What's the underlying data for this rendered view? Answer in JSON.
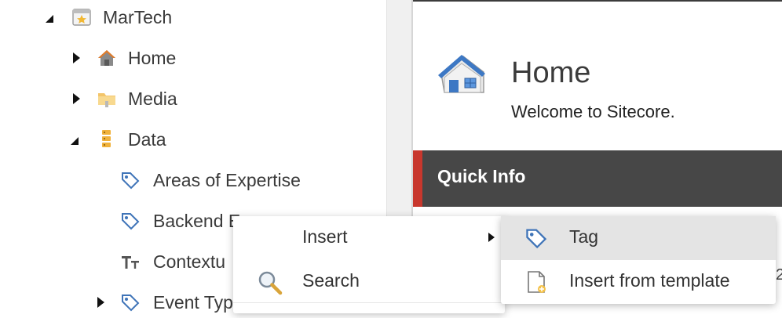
{
  "tree": {
    "items": [
      {
        "label": "MarTech",
        "icon": "website-star-icon",
        "arrow": "expanded"
      },
      {
        "label": "Home",
        "icon": "home-icon",
        "arrow": "collapsed"
      },
      {
        "label": "Media",
        "icon": "media-folder-icon",
        "arrow": "collapsed"
      },
      {
        "label": "Data",
        "icon": "data-stack-icon",
        "arrow": "expanded"
      },
      {
        "label": "Areas of Expertise",
        "icon": "tag-icon",
        "arrow": "none"
      },
      {
        "label": "Backend E",
        "icon": "tag-icon",
        "arrow": "none"
      },
      {
        "label": "Contextu",
        "icon": "text-type-icon",
        "arrow": "none"
      },
      {
        "label": "Event Typ",
        "icon": "tag-icon",
        "arrow": "collapsed"
      }
    ]
  },
  "content": {
    "title": "Home",
    "subtitle": "Welcome to Sitecore.",
    "section_label": "Quick Info",
    "peek_text": "2"
  },
  "context_menu": {
    "insert_label": "Insert",
    "search_label": "Search"
  },
  "submenu": {
    "tag_label": "Tag",
    "insert_template_label": "Insert from template"
  },
  "colors": {
    "quick_info_bg": "#474747",
    "quick_info_accent": "#c8372d",
    "submenu_highlight": "#e4e4e4"
  }
}
